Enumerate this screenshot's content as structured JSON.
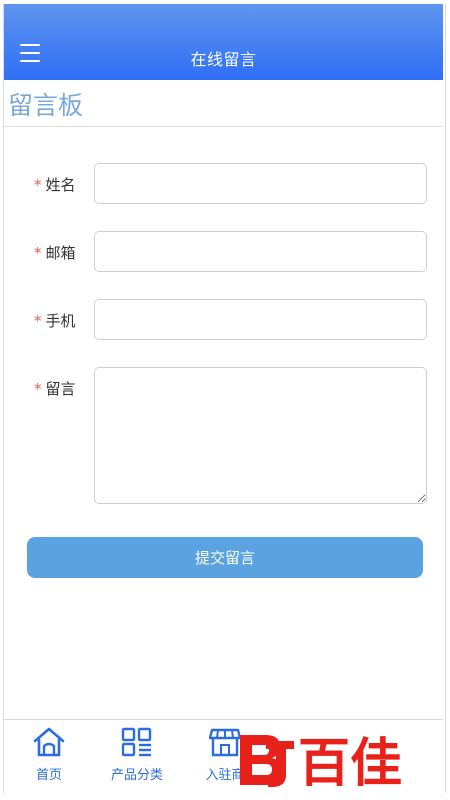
{
  "header": {
    "title": "在线留言",
    "menu_icon": "menu-icon"
  },
  "board": {
    "title": "留言板"
  },
  "form": {
    "required_mark": "*",
    "fields": [
      {
        "label": "姓名",
        "value": ""
      },
      {
        "label": "邮箱",
        "value": ""
      },
      {
        "label": "手机",
        "value": ""
      },
      {
        "label": "留言",
        "value": ""
      }
    ],
    "submit_label": "提交留言"
  },
  "tabbar": {
    "tabs": [
      {
        "label": "首页",
        "icon": "home-icon"
      },
      {
        "label": "产品分类",
        "icon": "grid-icon"
      },
      {
        "label": "入驻商",
        "icon": "store-icon"
      }
    ]
  },
  "watermark": {
    "text": "百佳",
    "logo_text": "BJ"
  },
  "colors": {
    "header_top": "#5f95ee",
    "header_bottom": "#2f6ff6",
    "accent": "#2b6de0",
    "submit": "#5aa2e0",
    "required": "#e05d4d",
    "watermark": "#e8211b"
  }
}
